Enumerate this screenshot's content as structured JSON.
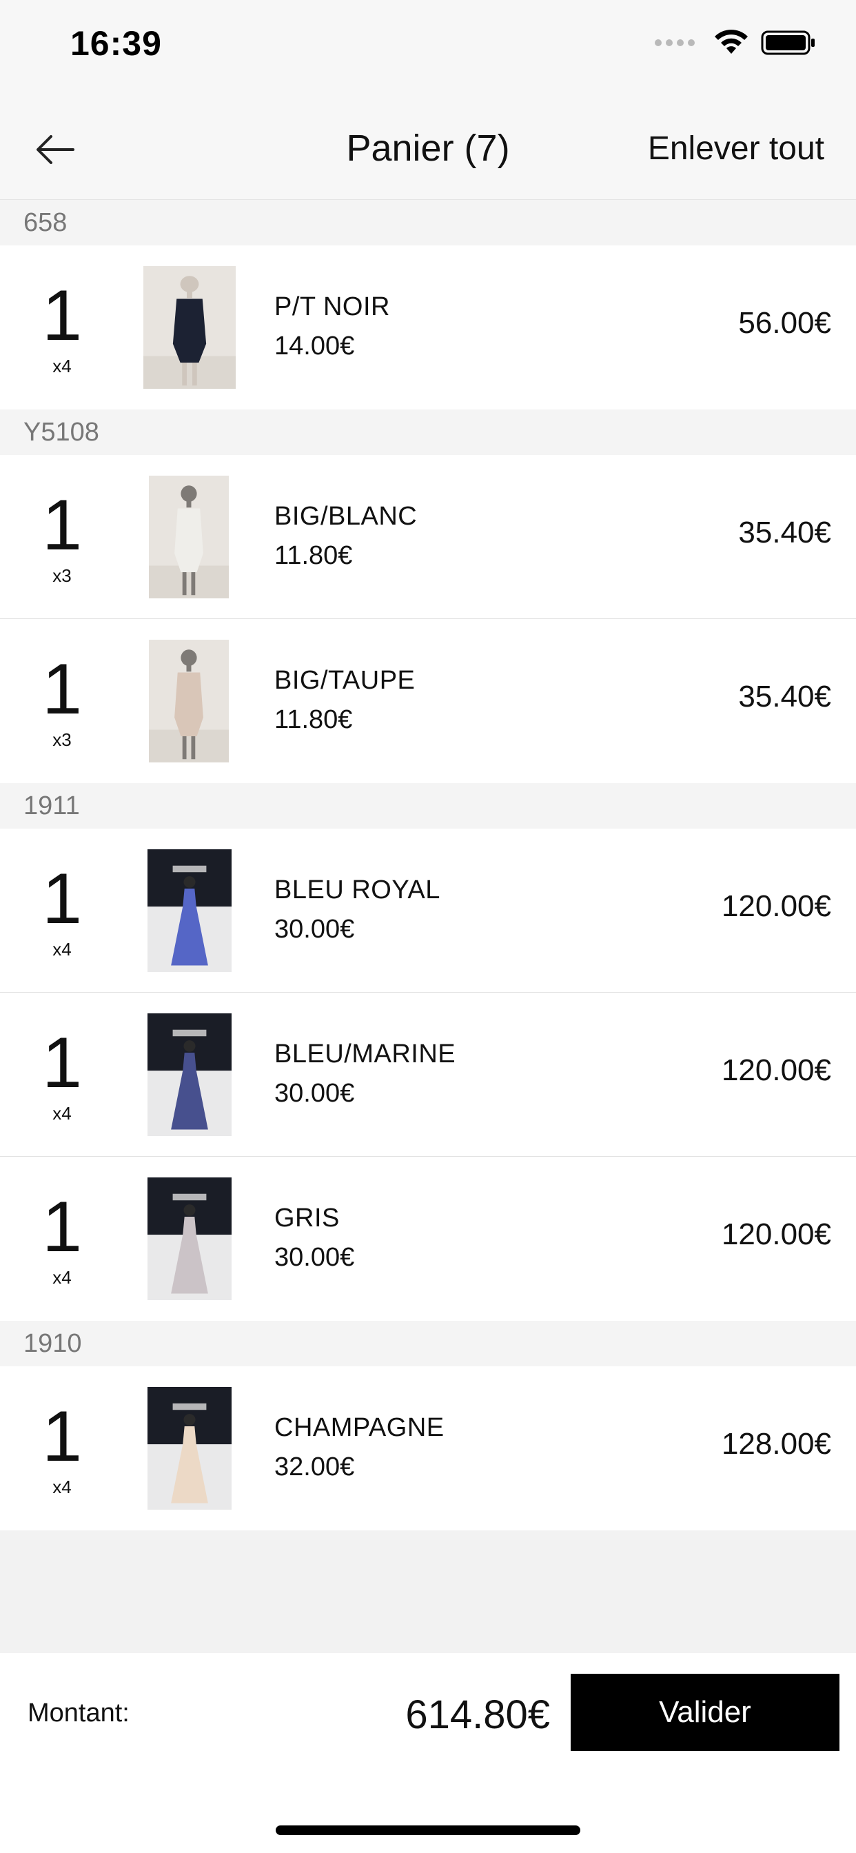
{
  "status_bar": {
    "time": "16:39"
  },
  "nav": {
    "title": "Panier (7)",
    "action": "Enlever tout"
  },
  "groups": [
    {
      "ref": "658",
      "items": [
        {
          "qty": "1",
          "mult": "x4",
          "name": "P/T NOIR",
          "unit_price": "14.00€",
          "total": "56.00€",
          "image": "short-dark-dress-photo",
          "colors": [
            "#1c2233",
            "#cfc6bd"
          ]
        }
      ]
    },
    {
      "ref": "Y5108",
      "items": [
        {
          "qty": "1",
          "mult": "x3",
          "name": "BIG/BLANC",
          "unit_price": "11.80€",
          "total": "35.40€",
          "image": "white-top-photo",
          "colors": [
            "#efeeea",
            "#7e7a76"
          ]
        },
        {
          "qty": "1",
          "mult": "x3",
          "name": "BIG/TAUPE",
          "unit_price": "11.80€",
          "total": "35.40€",
          "image": "taupe-top-photo",
          "colors": [
            "#d9c6b8",
            "#7e7a76"
          ]
        }
      ]
    },
    {
      "ref": "1911",
      "items": [
        {
          "qty": "1",
          "mult": "x4",
          "name": "BLEU ROYAL",
          "unit_price": "30.00€",
          "total": "120.00€",
          "image": "royal-blue-gown-photo",
          "colors": [
            "#5566c6",
            "#1b1f2b"
          ]
        },
        {
          "qty": "1",
          "mult": "x4",
          "name": "BLEU/MARINE",
          "unit_price": "30.00€",
          "total": "120.00€",
          "image": "navy-blue-gown-photo",
          "colors": [
            "#47508e",
            "#1b1f2b"
          ]
        },
        {
          "qty": "1",
          "mult": "x4",
          "name": "GRIS",
          "unit_price": "30.00€",
          "total": "120.00€",
          "image": "grey-gown-photo",
          "colors": [
            "#cbc3c7",
            "#1b1f2b"
          ]
        }
      ]
    },
    {
      "ref": "1910",
      "items": [
        {
          "qty": "1",
          "mult": "x4",
          "name": "CHAMPAGNE",
          "unit_price": "32.00€",
          "total": "128.00€",
          "image": "champagne-gown-photo",
          "colors": [
            "#ecd9c6",
            "#1b1f2b"
          ]
        }
      ]
    }
  ],
  "footer": {
    "total_label": "Montant:",
    "total_value": "614.80€",
    "validate_label": "Valider"
  }
}
